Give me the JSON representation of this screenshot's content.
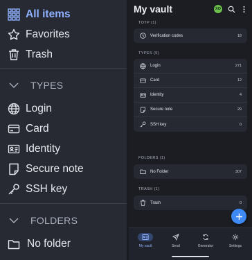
{
  "drawer": {
    "items": [
      {
        "label": "All items",
        "icon": "grid-icon",
        "active": true
      },
      {
        "label": "Favorites",
        "icon": "star-icon"
      },
      {
        "label": "Trash",
        "icon": "trash-icon"
      }
    ],
    "types_header": "TYPES",
    "types": [
      {
        "label": "Login",
        "icon": "globe-icon"
      },
      {
        "label": "Card",
        "icon": "card-icon"
      },
      {
        "label": "Identity",
        "icon": "id-card-icon"
      },
      {
        "label": "Secure note",
        "icon": "note-icon"
      },
      {
        "label": "SSH key",
        "icon": "key-icon"
      }
    ],
    "folders_header": "FOLDERS",
    "folders": [
      {
        "label": "No folder",
        "icon": "folder-icon"
      }
    ]
  },
  "vault": {
    "title": "My vault",
    "avatar_initials": "XO",
    "sections": {
      "totp": {
        "header": "TOTP (1)",
        "items": [
          {
            "label": "Verification codes",
            "count": "18",
            "icon": "clock-icon"
          }
        ]
      },
      "types": {
        "header": "TYPES (5)",
        "items": [
          {
            "label": "Login",
            "count": "271",
            "icon": "globe-icon"
          },
          {
            "label": "Card",
            "count": "12",
            "icon": "card-icon"
          },
          {
            "label": "Identity",
            "count": "4",
            "icon": "id-card-icon"
          },
          {
            "label": "Secure note",
            "count": "29",
            "icon": "note-icon"
          },
          {
            "label": "SSH key",
            "count": "0",
            "icon": "key-icon"
          }
        ]
      },
      "folders": {
        "header": "FOLDERS (1)",
        "items": [
          {
            "label": "No Folder",
            "count": "307",
            "icon": "folder-icon"
          }
        ]
      },
      "trash": {
        "header": "TRASH (1)",
        "items": [
          {
            "label": "Trash",
            "count": "0",
            "icon": "trash-icon"
          }
        ]
      }
    }
  },
  "nav": [
    {
      "label": "My vault",
      "icon": "vault-icon",
      "active": true
    },
    {
      "label": "Send",
      "icon": "send-icon"
    },
    {
      "label": "Generator",
      "icon": "refresh-icon"
    },
    {
      "label": "Settings",
      "icon": "gear-icon"
    }
  ],
  "colors": {
    "accent": "#8fb1ff",
    "fab": "#3d89f5",
    "avatar": "#6ec04d",
    "drawer_bg": "#272a33",
    "vault_bg": "#1b1d23"
  }
}
